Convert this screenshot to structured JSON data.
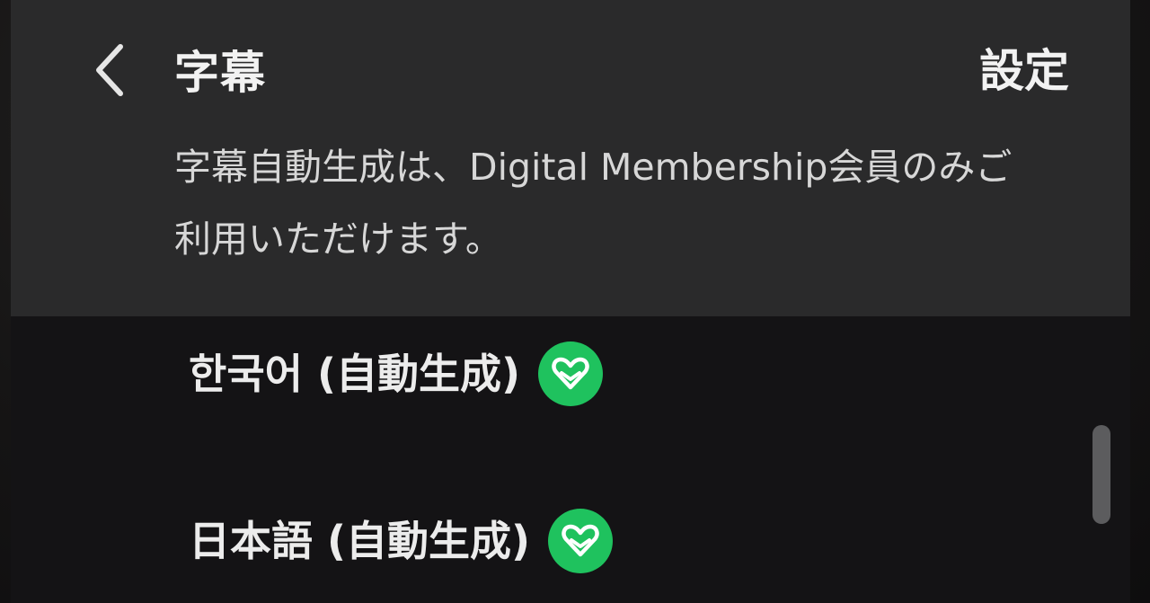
{
  "header": {
    "back_icon": "chevron-left-icon",
    "title": "字幕",
    "settings_label": "設定"
  },
  "notice": {
    "text": "字幕自動生成は、Digital Membership会員のみご利用いただけます。"
  },
  "subtitle_options": [
    {
      "label": "한국어 (自動生成)",
      "badge_icon": "membership-heart-badge-icon"
    },
    {
      "label": "日本語 (自動生成)",
      "badge_icon": "membership-heart-badge-icon"
    }
  ],
  "colors": {
    "header_bg": "#2a2a2b",
    "list_bg": "#141315",
    "badge_green": "#1fc25e",
    "text": "#f2f2f2"
  }
}
